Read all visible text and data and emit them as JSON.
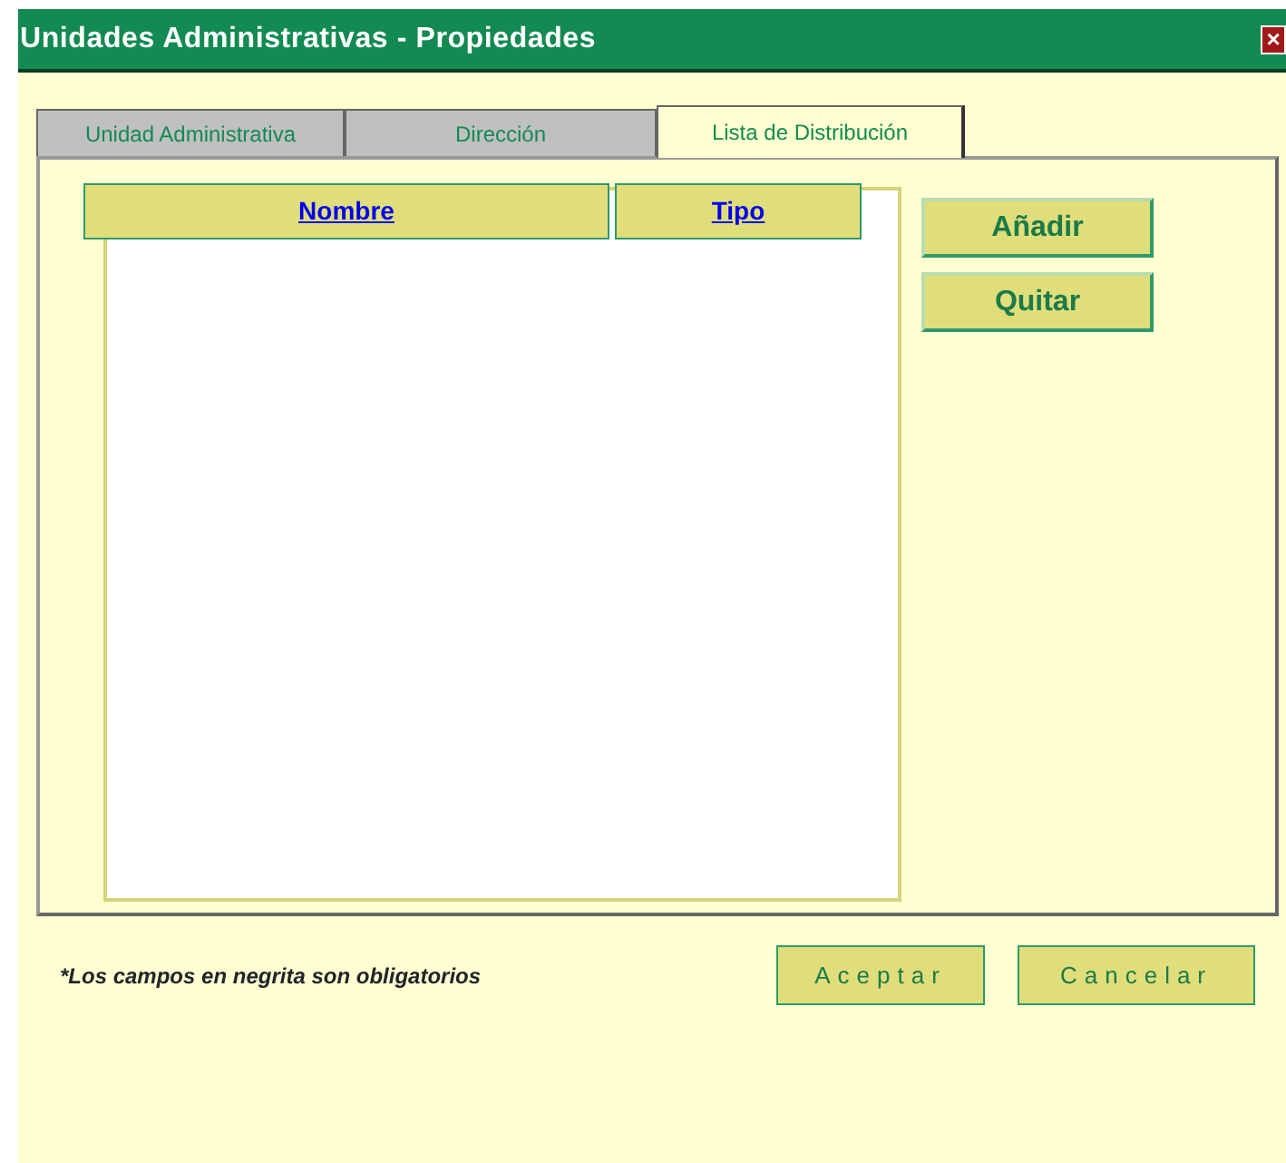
{
  "window": {
    "title": "Unidades Administrativas - Propiedades",
    "close": "×"
  },
  "tabs": [
    {
      "label": "Unidad Administrativa",
      "selected": false
    },
    {
      "label": "Dirección",
      "selected": false
    },
    {
      "label": "Lista de Distribución",
      "selected": true
    }
  ],
  "table": {
    "columns": [
      "Nombre",
      "Tipo"
    ]
  },
  "side_buttons": [
    "Añadir",
    "Quitar"
  ],
  "note": "*Los campos en negrita son obligatorios",
  "buttons": [
    "Aceptar",
    "Cancelar"
  ]
}
